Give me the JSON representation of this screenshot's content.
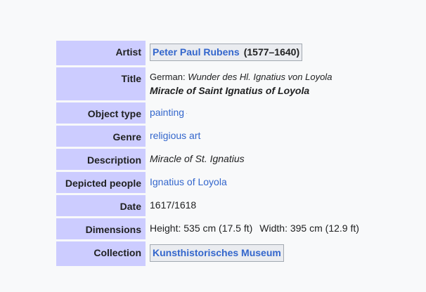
{
  "infobox": {
    "artist": {
      "label": "Artist",
      "name": "Peter Paul Rubens",
      "dates": "(1577–1640)"
    },
    "title": {
      "label": "Title",
      "lang_label": "German:",
      "lang_title": "Wunder des Hl. Ignatius von Loyola",
      "main": "Miracle of Saint Ignatius of Loyola"
    },
    "object_type": {
      "label": "Object type",
      "value": "painting"
    },
    "genre": {
      "label": "Genre",
      "value": "religious art"
    },
    "description": {
      "label": "Description",
      "value": "Miracle of St. Ignatius"
    },
    "depicted_people": {
      "label": "Depicted people",
      "value": "Ignatius of Loyola"
    },
    "date": {
      "label": "Date",
      "value": "1617/1618"
    },
    "dimensions": {
      "label": "Dimensions",
      "height": "Height: 535 cm (17.5 ft)",
      "width": "Width: 395 cm (12.9 ft)"
    },
    "collection": {
      "label": "Collection",
      "value": "Kunsthistorisches Museum"
    }
  },
  "colors": {
    "header_bg": "#ccccff",
    "link": "#3366cc",
    "page_bg": "#f8f9fa"
  }
}
